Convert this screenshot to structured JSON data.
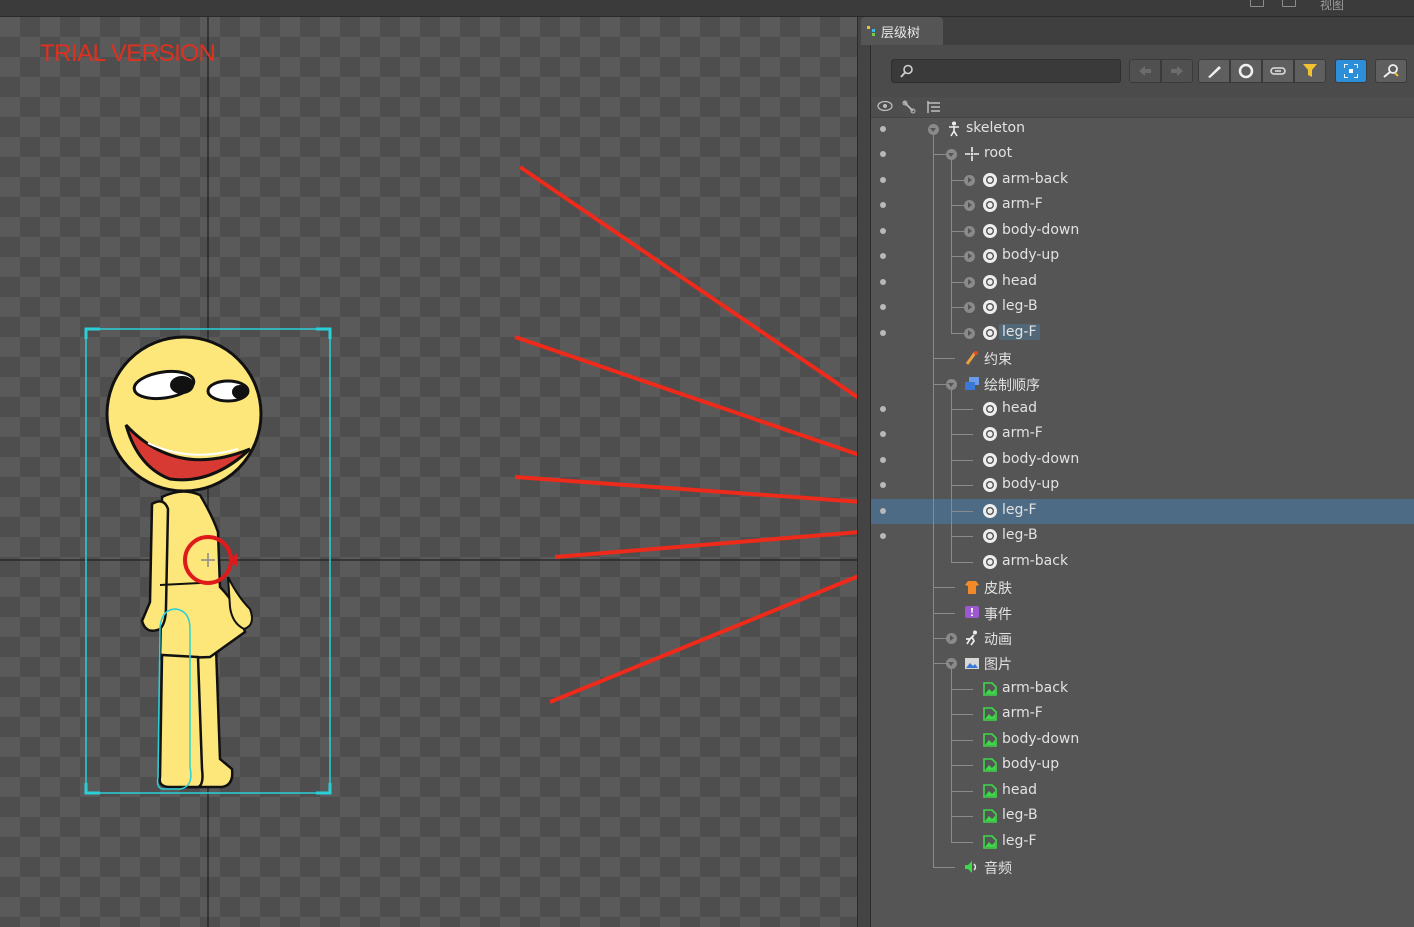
{
  "topbar": {
    "view_label": "视图"
  },
  "viewport": {
    "watermark": "TRIAL VERSION"
  },
  "panel": {
    "tab_label": "层级树",
    "search_placeholder": "",
    "toolbar_buttons": [
      "back-arrow-icon",
      "forward-arrow-icon",
      "bone-brush-icon",
      "circle-icon",
      "link-icon",
      "filter-icon",
      "focus-frame-icon",
      "key-search-icon"
    ],
    "columns": [
      "eye-icon",
      "bone-tool-icon",
      "tree-list-icon"
    ]
  },
  "tree": [
    {
      "label": "skeleton",
      "icon": "skeleton-icon",
      "level": 0,
      "expander": "open",
      "dot": true
    },
    {
      "label": "root",
      "icon": "root-bone-icon",
      "level": 1,
      "expander": "open",
      "dot": true
    },
    {
      "label": "arm-back",
      "icon": "slot-icon",
      "level": 2,
      "expander": "closed",
      "dot": true
    },
    {
      "label": "arm-F",
      "icon": "slot-icon",
      "level": 2,
      "expander": "closed",
      "dot": true
    },
    {
      "label": "body-down",
      "icon": "slot-icon",
      "level": 2,
      "expander": "closed",
      "dot": true
    },
    {
      "label": "body-up",
      "icon": "slot-icon",
      "level": 2,
      "expander": "closed",
      "dot": true
    },
    {
      "label": "head",
      "icon": "slot-icon",
      "level": 2,
      "expander": "closed",
      "dot": true
    },
    {
      "label": "leg-B",
      "icon": "slot-icon",
      "level": 2,
      "expander": "closed",
      "dot": true
    },
    {
      "label": "leg-F",
      "icon": "slot-icon",
      "level": 2,
      "expander": "closed",
      "dot": true,
      "highlight": true
    },
    {
      "label": "约束",
      "icon": "constraint-icon",
      "level": 1,
      "expander": "none",
      "dot": false
    },
    {
      "label": "绘制顺序",
      "icon": "draw-order-icon",
      "level": 1,
      "expander": "open",
      "dot": false
    },
    {
      "label": "head",
      "icon": "slot-icon",
      "level": 2,
      "expander": "none",
      "dot": true
    },
    {
      "label": "arm-F",
      "icon": "slot-icon",
      "level": 2,
      "expander": "none",
      "dot": true
    },
    {
      "label": "body-down",
      "icon": "slot-icon",
      "level": 2,
      "expander": "none",
      "dot": true
    },
    {
      "label": "body-up",
      "icon": "slot-icon",
      "level": 2,
      "expander": "none",
      "dot": true
    },
    {
      "label": "leg-F",
      "icon": "slot-icon",
      "level": 2,
      "expander": "none",
      "dot": true,
      "selected": true
    },
    {
      "label": "leg-B",
      "icon": "slot-icon",
      "level": 2,
      "expander": "none",
      "dot": true
    },
    {
      "label": "arm-back",
      "icon": "slot-icon",
      "level": 2,
      "expander": "none",
      "dot": false
    },
    {
      "label": "皮肤",
      "icon": "skin-icon",
      "level": 1,
      "expander": "none",
      "dot": false
    },
    {
      "label": "事件",
      "icon": "event-icon",
      "level": 1,
      "expander": "none",
      "dot": false
    },
    {
      "label": "动画",
      "icon": "animation-icon",
      "level": 1,
      "expander": "closed",
      "dot": false
    },
    {
      "label": "图片",
      "icon": "images-icon",
      "level": 1,
      "expander": "open",
      "dot": false
    },
    {
      "label": "arm-back",
      "icon": "image-file-icon",
      "level": 2,
      "expander": "none",
      "dot": false
    },
    {
      "label": "arm-F",
      "icon": "image-file-icon",
      "level": 2,
      "expander": "none",
      "dot": false
    },
    {
      "label": "body-down",
      "icon": "image-file-icon",
      "level": 2,
      "expander": "none",
      "dot": false
    },
    {
      "label": "body-up",
      "icon": "image-file-icon",
      "level": 2,
      "expander": "none",
      "dot": false
    },
    {
      "label": "head",
      "icon": "image-file-icon",
      "level": 2,
      "expander": "none",
      "dot": false
    },
    {
      "label": "leg-B",
      "icon": "image-file-icon",
      "level": 2,
      "expander": "none",
      "dot": false
    },
    {
      "label": "leg-F",
      "icon": "image-file-icon",
      "level": 2,
      "expander": "none",
      "dot": false
    },
    {
      "label": "音频",
      "icon": "audio-icon",
      "level": 1,
      "expander": "none",
      "dot": false
    }
  ],
  "colors": {
    "arrow": "#ee2a1b",
    "selection": "#4e6b85",
    "bounds": "#2ad0d8",
    "character": "#fde67a",
    "watermark": "#e0301e"
  }
}
